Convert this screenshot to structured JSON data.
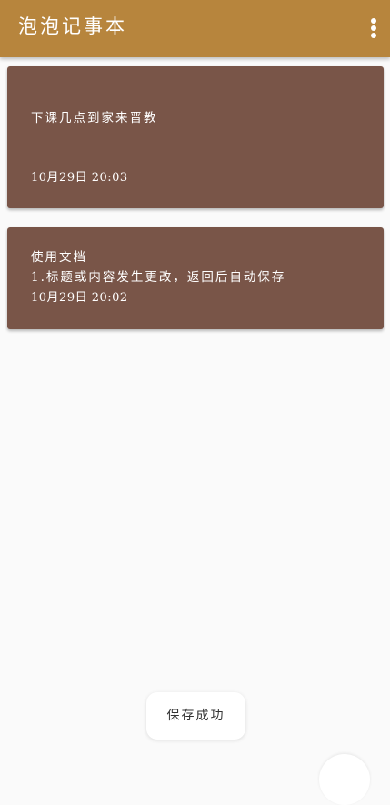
{
  "app_bar": {
    "title": "泡泡记事本",
    "menu_icon": "more-vertical-icon",
    "background": "#b7853d"
  },
  "notes": [
    {
      "text": "下课几点到家来晋教",
      "date": "10月29日  20:03"
    },
    {
      "text": "使用文档\n1.标题或内容发生更改，返回后自动保存",
      "date": "10月29日  20:02"
    }
  ],
  "note_card_color": "#795548",
  "toast": {
    "message": "保存成功"
  }
}
